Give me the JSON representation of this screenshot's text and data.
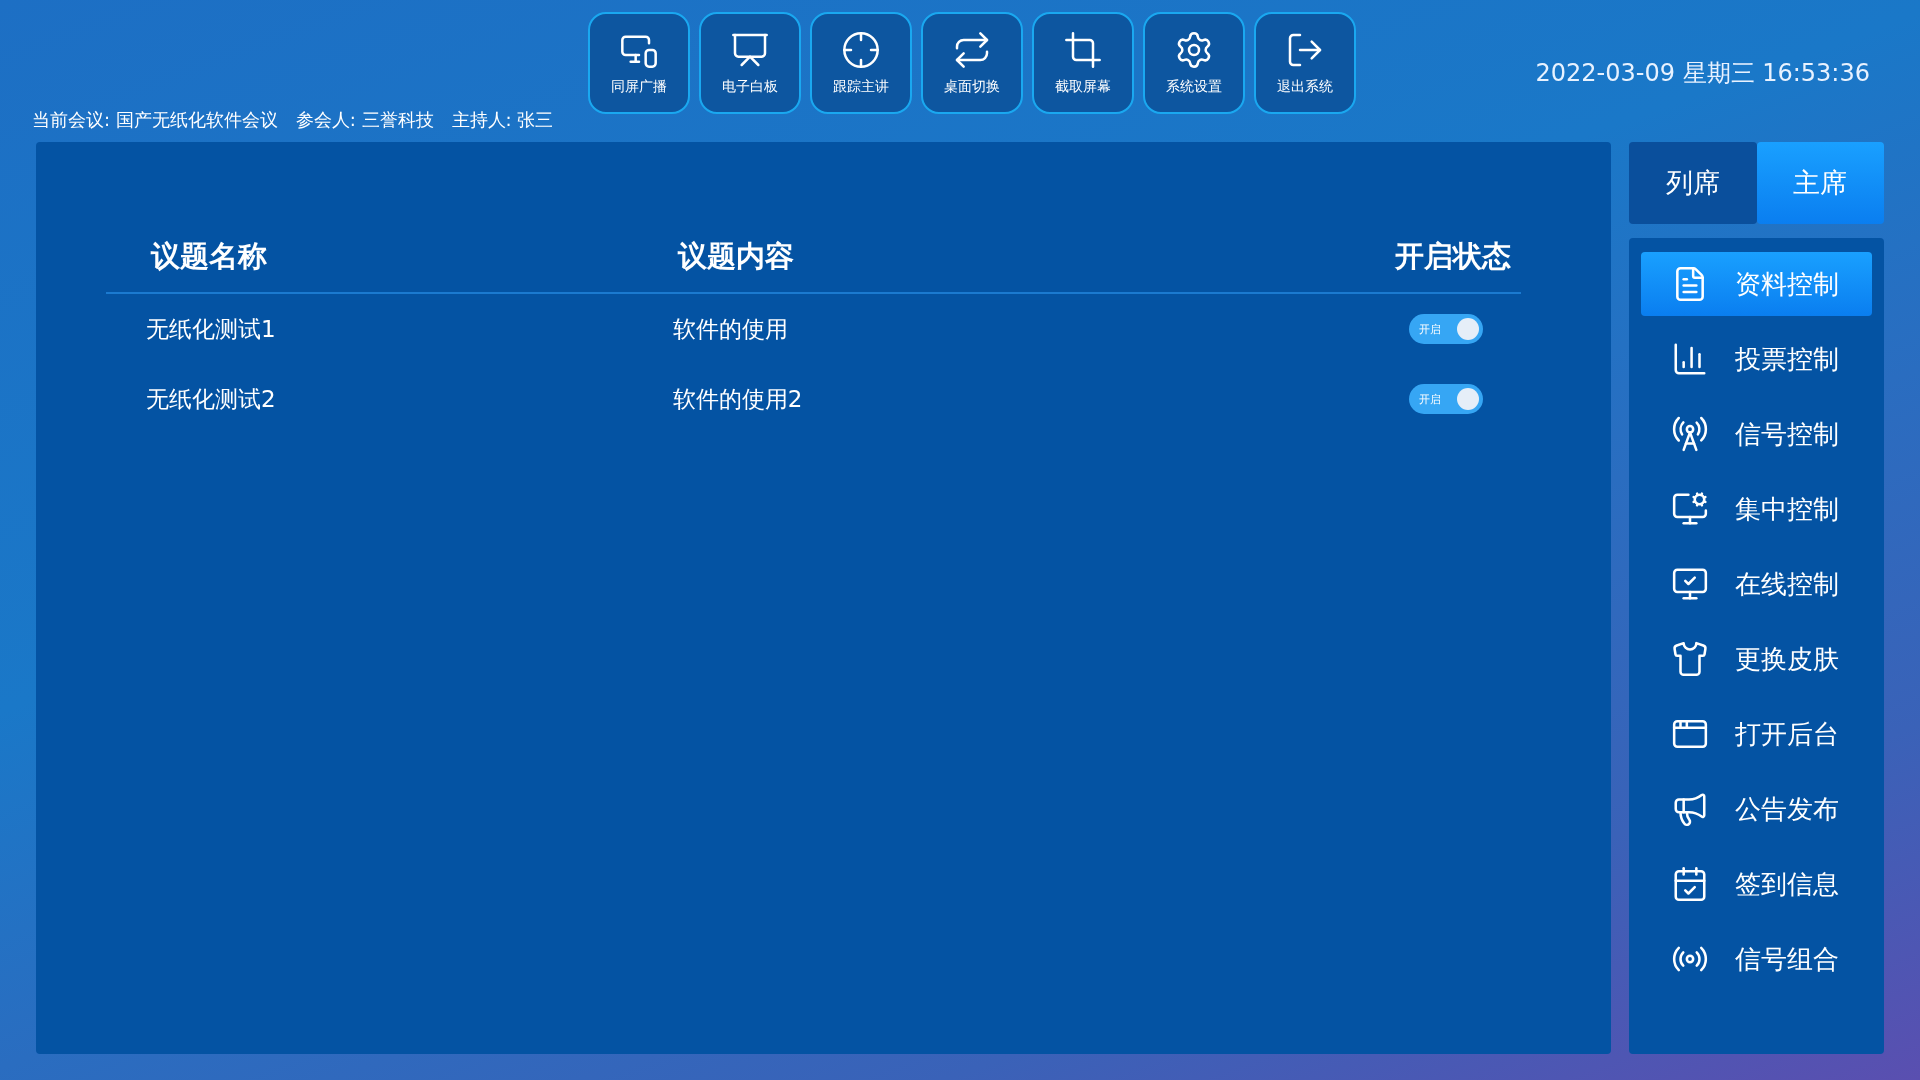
{
  "toolbar": [
    {
      "label": "同屏广播"
    },
    {
      "label": "电子白板"
    },
    {
      "label": "跟踪主讲"
    },
    {
      "label": "桌面切换"
    },
    {
      "label": "截取屏幕"
    },
    {
      "label": "系统设置"
    },
    {
      "label": "退出系统"
    }
  ],
  "datetime": "2022-03-09 星期三 16:53:36",
  "meeting_info": [
    "当前会议: 国产无纸化软件会议",
    "参会人: 三誉科技",
    "主持人: 张三"
  ],
  "table": {
    "columns": [
      "议题名称",
      "议题内容",
      "开启状态"
    ],
    "rows": [
      {
        "name": "无纸化测试1",
        "content": "软件的使用",
        "toggle_label": "开启",
        "on": true
      },
      {
        "name": "无纸化测试2",
        "content": "软件的使用2",
        "toggle_label": "开启",
        "on": true
      }
    ]
  },
  "seat_tabs": [
    {
      "label": "列席",
      "selected": false
    },
    {
      "label": "主席",
      "selected": true
    }
  ],
  "menu": [
    {
      "label": "资料控制",
      "selected": true
    },
    {
      "label": "投票控制",
      "selected": false
    },
    {
      "label": "信号控制",
      "selected": false
    },
    {
      "label": "集中控制",
      "selected": false
    },
    {
      "label": "在线控制",
      "selected": false
    },
    {
      "label": "更换皮肤",
      "selected": false
    },
    {
      "label": "打开后台",
      "selected": false
    },
    {
      "label": "公告发布",
      "selected": false
    },
    {
      "label": "签到信息",
      "selected": false
    },
    {
      "label": "信号组合",
      "selected": false
    }
  ]
}
